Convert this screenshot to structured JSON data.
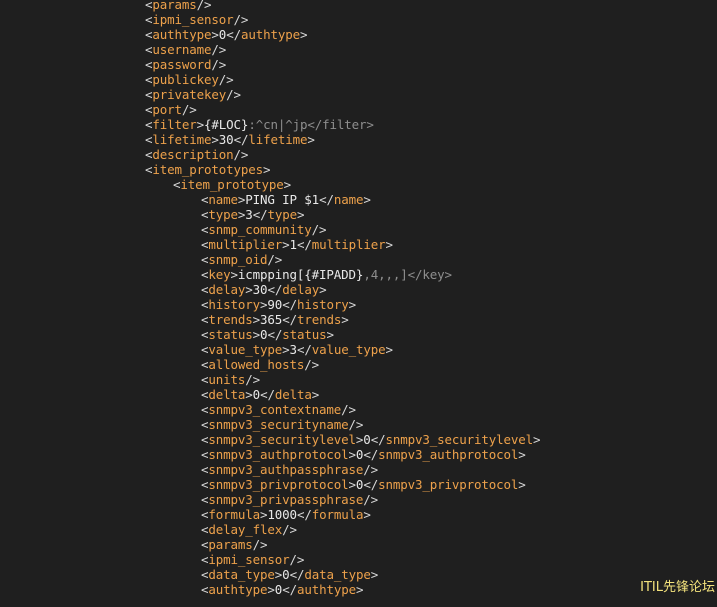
{
  "lines": [
    {
      "indent": 0,
      "segments": [
        {
          "k": "p",
          "v": "<"
        },
        {
          "k": "tag",
          "v": "params"
        },
        {
          "k": "p",
          "v": "/>"
        }
      ]
    },
    {
      "indent": 0,
      "segments": [
        {
          "k": "p",
          "v": "<"
        },
        {
          "k": "tag",
          "v": "ipmi_sensor"
        },
        {
          "k": "p",
          "v": "/>"
        }
      ]
    },
    {
      "indent": 0,
      "segments": [
        {
          "k": "p",
          "v": "<"
        },
        {
          "k": "tag",
          "v": "authtype"
        },
        {
          "k": "p",
          "v": ">"
        },
        {
          "k": "t",
          "v": "0"
        },
        {
          "k": "p",
          "v": "</"
        },
        {
          "k": "tag",
          "v": "authtype"
        },
        {
          "k": "p",
          "v": ">"
        }
      ]
    },
    {
      "indent": 0,
      "segments": [
        {
          "k": "p",
          "v": "<"
        },
        {
          "k": "tag",
          "v": "username"
        },
        {
          "k": "p",
          "v": "/>"
        }
      ]
    },
    {
      "indent": 0,
      "segments": [
        {
          "k": "p",
          "v": "<"
        },
        {
          "k": "tag",
          "v": "password"
        },
        {
          "k": "p",
          "v": "/>"
        }
      ]
    },
    {
      "indent": 0,
      "segments": [
        {
          "k": "p",
          "v": "<"
        },
        {
          "k": "tag",
          "v": "publickey"
        },
        {
          "k": "p",
          "v": "/>"
        }
      ]
    },
    {
      "indent": 0,
      "segments": [
        {
          "k": "p",
          "v": "<"
        },
        {
          "k": "tag",
          "v": "privatekey"
        },
        {
          "k": "p",
          "v": "/>"
        }
      ]
    },
    {
      "indent": 0,
      "segments": [
        {
          "k": "p",
          "v": "<"
        },
        {
          "k": "tag",
          "v": "port"
        },
        {
          "k": "p",
          "v": "/>"
        }
      ]
    },
    {
      "indent": 0,
      "segments": [
        {
          "k": "p",
          "v": "<"
        },
        {
          "k": "tag",
          "v": "filter"
        },
        {
          "k": "p",
          "v": ">"
        },
        {
          "k": "t",
          "v": "{#LOC}"
        },
        {
          "k": "g",
          "v": ":^cn|^jp</filter>"
        }
      ]
    },
    {
      "indent": 0,
      "segments": [
        {
          "k": "p",
          "v": "<"
        },
        {
          "k": "tag",
          "v": "lifetime"
        },
        {
          "k": "p",
          "v": ">"
        },
        {
          "k": "t",
          "v": "30"
        },
        {
          "k": "p",
          "v": "</"
        },
        {
          "k": "tag",
          "v": "lifetime"
        },
        {
          "k": "p",
          "v": ">"
        }
      ]
    },
    {
      "indent": 0,
      "segments": [
        {
          "k": "p",
          "v": "<"
        },
        {
          "k": "tag",
          "v": "description"
        },
        {
          "k": "p",
          "v": "/>"
        }
      ]
    },
    {
      "indent": 0,
      "segments": [
        {
          "k": "p",
          "v": "<"
        },
        {
          "k": "tag",
          "v": "item_prototypes"
        },
        {
          "k": "p",
          "v": ">"
        }
      ]
    },
    {
      "indent": 1,
      "segments": [
        {
          "k": "p",
          "v": "<"
        },
        {
          "k": "tag",
          "v": "item_prototype"
        },
        {
          "k": "p",
          "v": ">"
        }
      ]
    },
    {
      "indent": 2,
      "segments": [
        {
          "k": "p",
          "v": "<"
        },
        {
          "k": "tag",
          "v": "name"
        },
        {
          "k": "p",
          "v": ">"
        },
        {
          "k": "t",
          "v": "PING IP $1"
        },
        {
          "k": "p",
          "v": "</"
        },
        {
          "k": "tag",
          "v": "name"
        },
        {
          "k": "p",
          "v": ">"
        }
      ]
    },
    {
      "indent": 2,
      "segments": [
        {
          "k": "p",
          "v": "<"
        },
        {
          "k": "tag",
          "v": "type"
        },
        {
          "k": "p",
          "v": ">"
        },
        {
          "k": "t",
          "v": "3"
        },
        {
          "k": "p",
          "v": "</"
        },
        {
          "k": "tag",
          "v": "type"
        },
        {
          "k": "p",
          "v": ">"
        }
      ]
    },
    {
      "indent": 2,
      "segments": [
        {
          "k": "p",
          "v": "<"
        },
        {
          "k": "tag",
          "v": "snmp_community"
        },
        {
          "k": "p",
          "v": "/>"
        }
      ]
    },
    {
      "indent": 2,
      "segments": [
        {
          "k": "p",
          "v": "<"
        },
        {
          "k": "tag",
          "v": "multiplier"
        },
        {
          "k": "p",
          "v": ">"
        },
        {
          "k": "t",
          "v": "1"
        },
        {
          "k": "p",
          "v": "</"
        },
        {
          "k": "tag",
          "v": "multiplier"
        },
        {
          "k": "p",
          "v": ">"
        }
      ]
    },
    {
      "indent": 2,
      "segments": [
        {
          "k": "p",
          "v": "<"
        },
        {
          "k": "tag",
          "v": "snmp_oid"
        },
        {
          "k": "p",
          "v": "/>"
        }
      ]
    },
    {
      "indent": 2,
      "segments": [
        {
          "k": "p",
          "v": "<"
        },
        {
          "k": "tag",
          "v": "key"
        },
        {
          "k": "p",
          "v": ">"
        },
        {
          "k": "t",
          "v": "icmpping[{#IPADD}"
        },
        {
          "k": "g",
          "v": ",4,,,]</key>"
        }
      ]
    },
    {
      "indent": 2,
      "segments": [
        {
          "k": "p",
          "v": "<"
        },
        {
          "k": "tag",
          "v": "delay"
        },
        {
          "k": "p",
          "v": ">"
        },
        {
          "k": "t",
          "v": "30"
        },
        {
          "k": "p",
          "v": "</"
        },
        {
          "k": "tag",
          "v": "delay"
        },
        {
          "k": "p",
          "v": ">"
        }
      ]
    },
    {
      "indent": 2,
      "segments": [
        {
          "k": "p",
          "v": "<"
        },
        {
          "k": "tag",
          "v": "history"
        },
        {
          "k": "p",
          "v": ">"
        },
        {
          "k": "t",
          "v": "90"
        },
        {
          "k": "p",
          "v": "</"
        },
        {
          "k": "tag",
          "v": "history"
        },
        {
          "k": "p",
          "v": ">"
        }
      ]
    },
    {
      "indent": 2,
      "segments": [
        {
          "k": "p",
          "v": "<"
        },
        {
          "k": "tag",
          "v": "trends"
        },
        {
          "k": "p",
          "v": ">"
        },
        {
          "k": "t",
          "v": "365"
        },
        {
          "k": "p",
          "v": "</"
        },
        {
          "k": "tag",
          "v": "trends"
        },
        {
          "k": "p",
          "v": ">"
        }
      ]
    },
    {
      "indent": 2,
      "segments": [
        {
          "k": "p",
          "v": "<"
        },
        {
          "k": "tag",
          "v": "status"
        },
        {
          "k": "p",
          "v": ">"
        },
        {
          "k": "t",
          "v": "0"
        },
        {
          "k": "p",
          "v": "</"
        },
        {
          "k": "tag",
          "v": "status"
        },
        {
          "k": "p",
          "v": ">"
        }
      ]
    },
    {
      "indent": 2,
      "segments": [
        {
          "k": "p",
          "v": "<"
        },
        {
          "k": "tag",
          "v": "value_type"
        },
        {
          "k": "p",
          "v": ">"
        },
        {
          "k": "t",
          "v": "3"
        },
        {
          "k": "p",
          "v": "</"
        },
        {
          "k": "tag",
          "v": "value_type"
        },
        {
          "k": "p",
          "v": ">"
        }
      ]
    },
    {
      "indent": 2,
      "segments": [
        {
          "k": "p",
          "v": "<"
        },
        {
          "k": "tag",
          "v": "allowed_hosts"
        },
        {
          "k": "p",
          "v": "/>"
        }
      ]
    },
    {
      "indent": 2,
      "segments": [
        {
          "k": "p",
          "v": "<"
        },
        {
          "k": "tag",
          "v": "units"
        },
        {
          "k": "p",
          "v": "/>"
        }
      ]
    },
    {
      "indent": 2,
      "segments": [
        {
          "k": "p",
          "v": "<"
        },
        {
          "k": "tag",
          "v": "delta"
        },
        {
          "k": "p",
          "v": ">"
        },
        {
          "k": "t",
          "v": "0"
        },
        {
          "k": "p",
          "v": "</"
        },
        {
          "k": "tag",
          "v": "delta"
        },
        {
          "k": "p",
          "v": ">"
        }
      ]
    },
    {
      "indent": 2,
      "segments": [
        {
          "k": "p",
          "v": "<"
        },
        {
          "k": "tag",
          "v": "snmpv3_contextname"
        },
        {
          "k": "p",
          "v": "/>"
        }
      ]
    },
    {
      "indent": 2,
      "segments": [
        {
          "k": "p",
          "v": "<"
        },
        {
          "k": "tag",
          "v": "snmpv3_securityname"
        },
        {
          "k": "p",
          "v": "/>"
        }
      ]
    },
    {
      "indent": 2,
      "segments": [
        {
          "k": "p",
          "v": "<"
        },
        {
          "k": "tag",
          "v": "snmpv3_securitylevel"
        },
        {
          "k": "p",
          "v": ">"
        },
        {
          "k": "t",
          "v": "0"
        },
        {
          "k": "p",
          "v": "</"
        },
        {
          "k": "tag",
          "v": "snmpv3_securitylevel"
        },
        {
          "k": "p",
          "v": ">"
        }
      ]
    },
    {
      "indent": 2,
      "segments": [
        {
          "k": "p",
          "v": "<"
        },
        {
          "k": "tag",
          "v": "snmpv3_authprotocol"
        },
        {
          "k": "p",
          "v": ">"
        },
        {
          "k": "t",
          "v": "0"
        },
        {
          "k": "p",
          "v": "</"
        },
        {
          "k": "tag",
          "v": "snmpv3_authprotocol"
        },
        {
          "k": "p",
          "v": ">"
        }
      ]
    },
    {
      "indent": 2,
      "segments": [
        {
          "k": "p",
          "v": "<"
        },
        {
          "k": "tag",
          "v": "snmpv3_authpassphrase"
        },
        {
          "k": "p",
          "v": "/>"
        }
      ]
    },
    {
      "indent": 2,
      "segments": [
        {
          "k": "p",
          "v": "<"
        },
        {
          "k": "tag",
          "v": "snmpv3_privprotocol"
        },
        {
          "k": "p",
          "v": ">"
        },
        {
          "k": "t",
          "v": "0"
        },
        {
          "k": "p",
          "v": "</"
        },
        {
          "k": "tag",
          "v": "snmpv3_privprotocol"
        },
        {
          "k": "p",
          "v": ">"
        }
      ]
    },
    {
      "indent": 2,
      "segments": [
        {
          "k": "p",
          "v": "<"
        },
        {
          "k": "tag",
          "v": "snmpv3_privpassphrase"
        },
        {
          "k": "p",
          "v": "/>"
        }
      ]
    },
    {
      "indent": 2,
      "segments": [
        {
          "k": "p",
          "v": "<"
        },
        {
          "k": "tag",
          "v": "formula"
        },
        {
          "k": "p",
          "v": ">"
        },
        {
          "k": "t",
          "v": "1000"
        },
        {
          "k": "p",
          "v": "</"
        },
        {
          "k": "tag",
          "v": "formula"
        },
        {
          "k": "p",
          "v": ">"
        }
      ]
    },
    {
      "indent": 2,
      "segments": [
        {
          "k": "p",
          "v": "<"
        },
        {
          "k": "tag",
          "v": "delay_flex"
        },
        {
          "k": "p",
          "v": "/>"
        }
      ]
    },
    {
      "indent": 2,
      "segments": [
        {
          "k": "p",
          "v": "<"
        },
        {
          "k": "tag",
          "v": "params"
        },
        {
          "k": "p",
          "v": "/>"
        }
      ]
    },
    {
      "indent": 2,
      "segments": [
        {
          "k": "p",
          "v": "<"
        },
        {
          "k": "tag",
          "v": "ipmi_sensor"
        },
        {
          "k": "p",
          "v": "/>"
        }
      ]
    },
    {
      "indent": 2,
      "segments": [
        {
          "k": "p",
          "v": "<"
        },
        {
          "k": "tag",
          "v": "data_type"
        },
        {
          "k": "p",
          "v": ">"
        },
        {
          "k": "t",
          "v": "0"
        },
        {
          "k": "p",
          "v": "</"
        },
        {
          "k": "tag",
          "v": "data_type"
        },
        {
          "k": "p",
          "v": ">"
        }
      ]
    },
    {
      "indent": 2,
      "segments": [
        {
          "k": "p",
          "v": "<"
        },
        {
          "k": "tag",
          "v": "authtype"
        },
        {
          "k": "p",
          "v": ">"
        },
        {
          "k": "t",
          "v": "0"
        },
        {
          "k": "p",
          "v": "</"
        },
        {
          "k": "tag",
          "v": "authtype"
        },
        {
          "k": "p",
          "v": ">"
        }
      ]
    }
  ],
  "watermark": "ITIL先锋论坛",
  "colors": {
    "background": "#1f1f1f",
    "tag": "#eda14b",
    "text": "#e8e8e8",
    "punct": "#d8d8d8",
    "dim": "#8e8e8e",
    "watermark": "#f3e27c"
  }
}
